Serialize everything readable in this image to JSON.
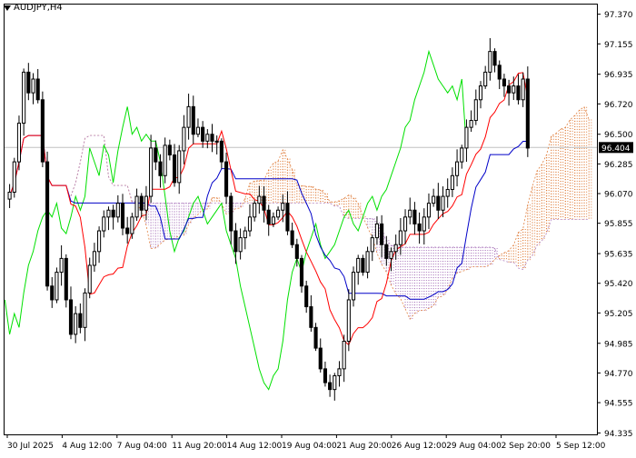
{
  "symbol_title": "AUDJPY,H4",
  "colors": {
    "background": "#ffffff",
    "frame": "#000000",
    "candle": "#000000",
    "tenkan": "#ff0000",
    "kijun": "#0000c8",
    "chikou": "#00e000",
    "kumo_bull": "#e08040",
    "kumo_bear": "#b080c0",
    "price_line": "#c0c0c0",
    "price_label_bg": "#000000",
    "price_label_text": "#ffffff"
  },
  "chart_data": {
    "type": "candlestick",
    "instrument": "AUDJPY",
    "timeframe": "H4",
    "indicator": "Ichimoku Kinko Hyo",
    "ylim": [
      94.325,
      97.44
    ],
    "y_ticks": [
      "97.370",
      "97.155",
      "96.935",
      "96.720",
      "96.500",
      "96.285",
      "96.070",
      "95.855",
      "95.635",
      "95.420",
      "95.205",
      "94.985",
      "94.770",
      "94.555",
      "94.335"
    ],
    "x_labels": [
      "30 Jul 2025",
      "4 Aug 12:00",
      "7 Aug 04:00",
      "11 Aug 20:00",
      "14 Aug 12:00",
      "19 Aug 04:00",
      "21 Aug 20:00",
      "26 Aug 12:00",
      "29 Aug 04:00",
      "2 Sep 20:00",
      "5 Sep 12:00"
    ],
    "current_price": "96.404",
    "closes": [
      96.08,
      96.3,
      96.58,
      96.95,
      96.8,
      96.9,
      96.75,
      96.3,
      95.4,
      95.3,
      95.5,
      95.6,
      95.3,
      95.05,
      95.2,
      95.1,
      95.35,
      95.55,
      95.65,
      95.8,
      95.9,
      95.95,
      95.9,
      96.0,
      95.82,
      95.78,
      95.9,
      96.05,
      95.95,
      96.05,
      96.4,
      96.3,
      96.2,
      96.42,
      96.35,
      96.15,
      96.38,
      96.55,
      96.7,
      96.5,
      96.55,
      96.45,
      96.5,
      96.45,
      96.45,
      96.3,
      96.05,
      95.8,
      95.65,
      95.75,
      95.8,
      95.9,
      96.0,
      96.05,
      95.95,
      95.85,
      95.9,
      95.95,
      96.0,
      95.8,
      95.7,
      95.6,
      95.4,
      95.25,
      95.1,
      94.95,
      94.8,
      94.7,
      94.65,
      94.75,
      94.8,
      95.0,
      95.3,
      95.5,
      95.6,
      95.5,
      95.65,
      95.75,
      95.85,
      95.7,
      95.6,
      95.65,
      95.7,
      95.8,
      95.9,
      95.95,
      95.85,
      95.8,
      95.9,
      96.0,
      96.05,
      95.95,
      96.05,
      96.1,
      96.2,
      96.3,
      96.4,
      96.55,
      96.6,
      96.75,
      96.85,
      96.95,
      97.1,
      97.0,
      96.9,
      96.85,
      96.8,
      96.85,
      96.75,
      96.9,
      96.4
    ]
  }
}
